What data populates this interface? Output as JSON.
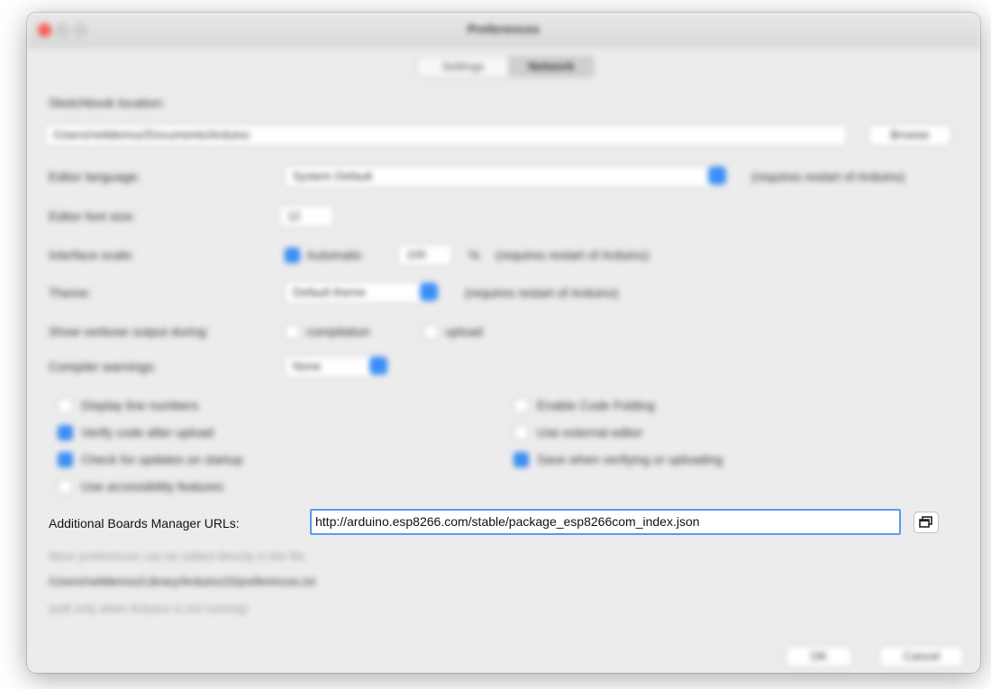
{
  "window": {
    "title": "Preferences"
  },
  "tabs": [
    {
      "label": "Settings"
    },
    {
      "label": "Network"
    }
  ],
  "sketchbook": {
    "label": "Sketchbook location:",
    "value": "/Users/neildemoz/Documents/Arduino",
    "browse_label": "Browse"
  },
  "editor_language": {
    "label": "Editor language:",
    "value": "System Default",
    "note": "(requires restart of Arduino)"
  },
  "font_size": {
    "label": "Editor font size:",
    "value": "12"
  },
  "interface_scale": {
    "label": "Interface scale:",
    "automatic_label": "Automatic",
    "value": "100",
    "unit": "%",
    "note": "(requires restart of Arduino)"
  },
  "theme": {
    "label": "Theme:",
    "value": "Default theme",
    "note": "(requires restart of Arduino)"
  },
  "verbose": {
    "label": "Show verbose output during:",
    "compilation_label": "compilation",
    "upload_label": "upload"
  },
  "compiler_warnings": {
    "label": "Compiler warnings:",
    "value": "None"
  },
  "options": {
    "left": [
      {
        "label": "Display line numbers",
        "checked": false
      },
      {
        "label": "Verify code after upload",
        "checked": true
      },
      {
        "label": "Check for updates on startup",
        "checked": true
      },
      {
        "label": "Use accessibility features",
        "checked": false
      }
    ],
    "right": [
      {
        "label": "Enable Code Folding",
        "checked": false
      },
      {
        "label": "Use external editor",
        "checked": false
      },
      {
        "label": "Save when verifying or uploading",
        "checked": true
      }
    ]
  },
  "boards_manager": {
    "label": "Additional Boards Manager URLs:",
    "value": "http://arduino.esp8266.com/stable/package_esp8266com_index.json"
  },
  "footer_hint": {
    "line1": "More preferences can be edited directly in the file",
    "path": "/Users/neildemoz/Library/Arduino15/preferences.txt",
    "line3": "(edit only when Arduino is not running)"
  },
  "buttons": {
    "ok": "OK",
    "cancel": "Cancel"
  }
}
